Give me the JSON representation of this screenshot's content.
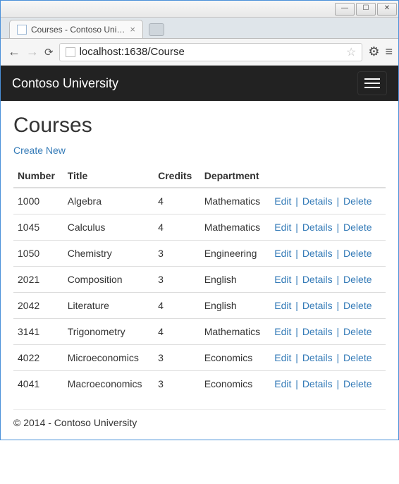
{
  "browser": {
    "tab_title": "Courses - Contoso Univers",
    "url_display_prefix": "localhost:",
    "url_display_port": "1638",
    "url_display_path": "/Course"
  },
  "navbar": {
    "brand": "Contoso University"
  },
  "page": {
    "heading": "Courses",
    "create_new_label": "Create New"
  },
  "table": {
    "headers": {
      "number": "Number",
      "title": "Title",
      "credits": "Credits",
      "department": "Department"
    },
    "action_labels": {
      "edit": "Edit",
      "details": "Details",
      "delete": "Delete"
    },
    "rows": [
      {
        "number": "1000",
        "title": "Algebra",
        "credits": "4",
        "department": "Mathematics"
      },
      {
        "number": "1045",
        "title": "Calculus",
        "credits": "4",
        "department": "Mathematics"
      },
      {
        "number": "1050",
        "title": "Chemistry",
        "credits": "3",
        "department": "Engineering"
      },
      {
        "number": "2021",
        "title": "Composition",
        "credits": "3",
        "department": "English"
      },
      {
        "number": "2042",
        "title": "Literature",
        "credits": "4",
        "department": "English"
      },
      {
        "number": "3141",
        "title": "Trigonometry",
        "credits": "4",
        "department": "Mathematics"
      },
      {
        "number": "4022",
        "title": "Microeconomics",
        "credits": "3",
        "department": "Economics"
      },
      {
        "number": "4041",
        "title": "Macroeconomics",
        "credits": "3",
        "department": "Economics"
      }
    ]
  },
  "footer": {
    "text": "© 2014 - Contoso University"
  }
}
